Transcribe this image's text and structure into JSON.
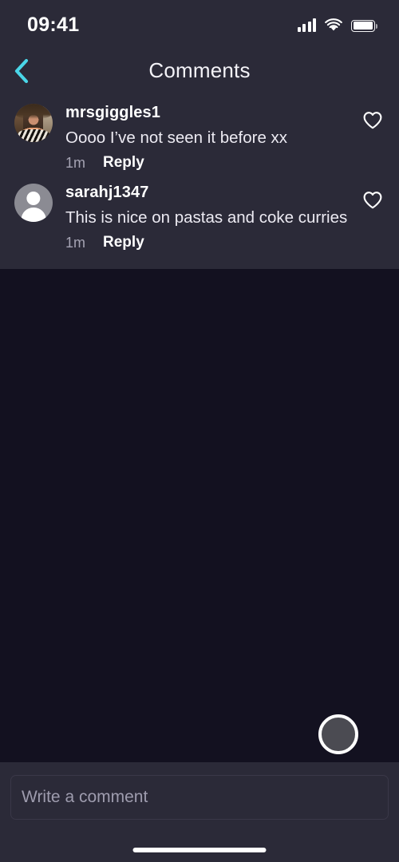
{
  "status_bar": {
    "time": "09:41",
    "signal_icon": "cellular-signal-icon",
    "wifi_icon": "wifi-icon",
    "battery_icon": "battery-full-icon"
  },
  "header": {
    "title": "Comments",
    "back_icon": "chevron-left-icon",
    "back_icon_color": "#4ad6e8"
  },
  "comments": [
    {
      "username": "mrsgiggles1",
      "text": "Oooo I’ve not seen it before xx",
      "time": "1m",
      "reply_label": "Reply",
      "avatar_type": "photo",
      "like_icon": "heart-outline-icon"
    },
    {
      "username": "sarahj1347",
      "text": "This is nice on pastas and coke curries",
      "time": "1m",
      "reply_label": "Reply",
      "avatar_type": "placeholder",
      "like_icon": "heart-outline-icon"
    }
  ],
  "media": {
    "capture_button_label": "capture-button",
    "background_color": "#131120"
  },
  "compose": {
    "placeholder": "Write a comment",
    "value": ""
  },
  "system": {
    "home_indicator": "home-indicator-bar"
  },
  "colors": {
    "panel_background": "#2b2a38",
    "media_background": "#131120",
    "accent": "#4ad6e8",
    "text_primary": "#ffffff",
    "text_muted": "#a5a3b3"
  }
}
